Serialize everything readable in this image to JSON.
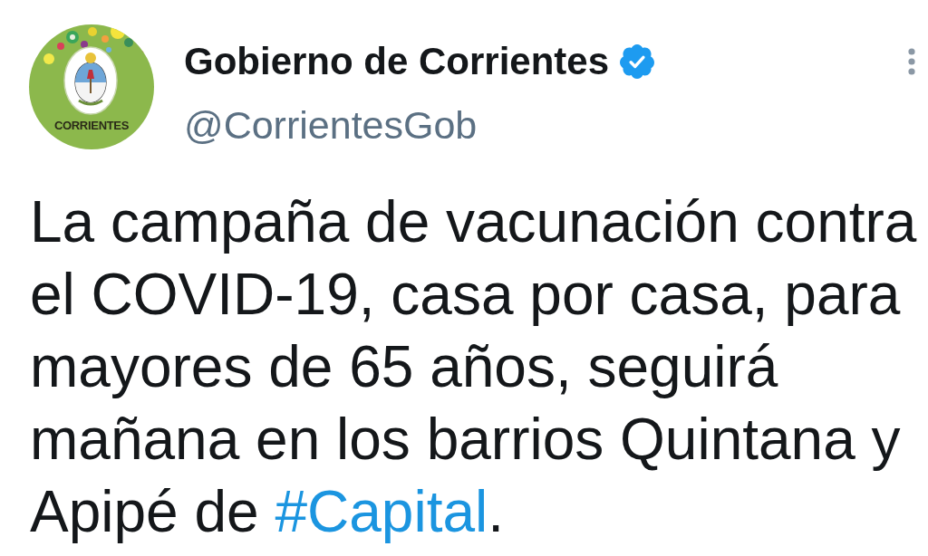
{
  "account": {
    "avatar": {
      "label": "CORRIENTES"
    },
    "name": "Gobierno de Corrientes",
    "verified": true,
    "handle": "@CorrientesGob"
  },
  "tweet": {
    "segments": [
      {
        "kind": "text",
        "text": "La campaña de vacunación contra el COVID-19, casa por casa, para mayores de 65 años, seguirá mañana en los barrios Quintana y Apipé de "
      },
      {
        "kind": "hashtag",
        "text": "#Capital"
      },
      {
        "kind": "text",
        "text": "."
      }
    ]
  }
}
